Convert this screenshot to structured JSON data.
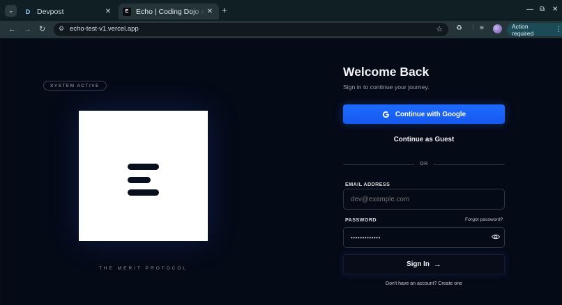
{
  "browser": {
    "tabs": [
      {
        "label": "Devpost",
        "favicon": "D",
        "active": false
      },
      {
        "label": "Echo | Coding Dojo and C",
        "favicon": "E",
        "active": true
      }
    ],
    "new_tab_icon": "plus-icon",
    "url": "echo-test-v1.vercel.app",
    "action_required": "Action required"
  },
  "hero": {
    "status_badge": "SYSTEM ACTIVE",
    "tagline": "THE MERIT PROTOCOL"
  },
  "auth": {
    "title": "Welcome Back",
    "subtitle": "Sign in to continue your journey.",
    "google_button": "Continue with Google",
    "guest_button": "Continue as Guest",
    "divider": "OR",
    "email_label": "EMAIL ADDRESS",
    "email_placeholder": "dev@example.com",
    "password_label": "PASSWORD",
    "forgot_link": "Forgot password?",
    "password_value": "•••••••••••••",
    "signin_button": "Sign In",
    "signup_text": "Don't have an account? Create one"
  },
  "colors": {
    "background": "#050a17",
    "primary": "#1f6bff",
    "browser_frame": "#0f1f24"
  }
}
